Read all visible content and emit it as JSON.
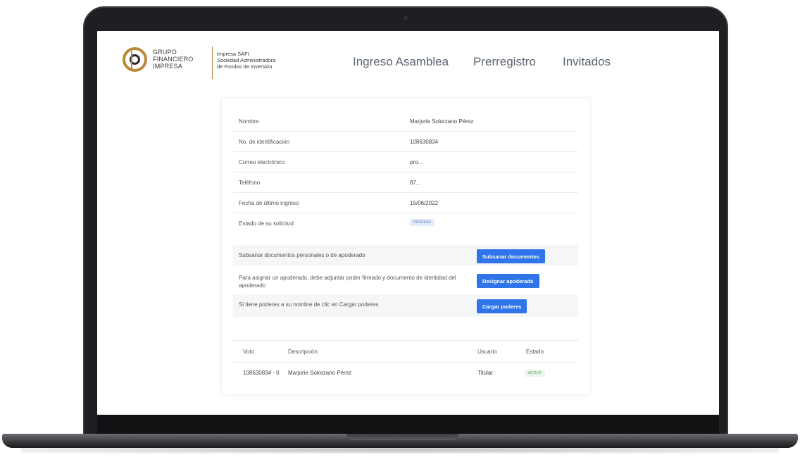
{
  "brand": {
    "left_lines": [
      "GRUPO",
      "FINANCIERO",
      "IMPRESA"
    ],
    "right_lines": [
      "Impresa SAFI",
      "Sociedad Administradora",
      "de Fondos de Inversión"
    ]
  },
  "nav": {
    "items": [
      "Ingreso Asamblea",
      "Prerregistro",
      "Invitados"
    ]
  },
  "profile": {
    "rows": [
      {
        "label": "Nombre",
        "value": "Marjorie Solorzano Pérez"
      },
      {
        "label": "No. de identificación",
        "value": "108630834"
      },
      {
        "label": "Correo electrónico",
        "value": "pro..."
      },
      {
        "label": "Teléfono",
        "value": "87..."
      },
      {
        "label": "Fecha de último ingreso",
        "value": "15/06/2022"
      }
    ],
    "status_label": "Estado de su solicitud",
    "status_value": "PROCESO"
  },
  "actions": [
    {
      "text": "Subsanar documentos personales o de apoderado",
      "button": "Subsanar documentos"
    },
    {
      "text": "Para asignar un apoderado, debe adjuntar poder firmado y documento de identidad del apoderado",
      "button": "Designar apoderado"
    },
    {
      "text": "Si tiene poderes a su nombre de clic en Cargar poderes",
      "button": "Cargar poderes"
    }
  ],
  "votes_table": {
    "headers": [
      "Voto",
      "Descripción",
      "Usuario",
      "Estado"
    ],
    "rows": [
      {
        "voto": "108630834 - 0",
        "descripcion": "Marjorie Solorzano Pérez",
        "usuario": "Titular",
        "estado": "ACTIVO"
      }
    ]
  },
  "colors": {
    "accent": "#2f74e8",
    "brand_gold": "#b88a3a"
  }
}
